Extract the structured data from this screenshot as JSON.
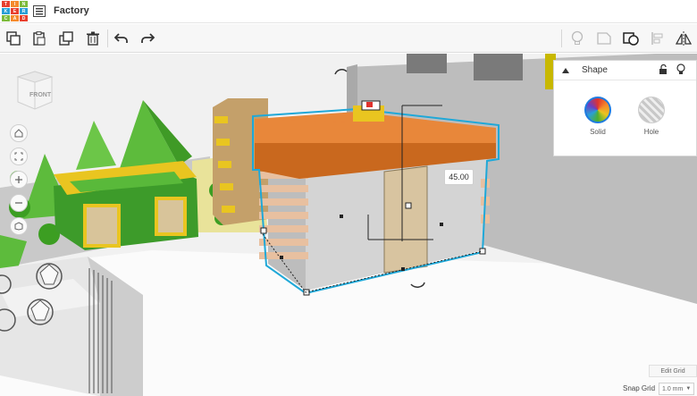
{
  "app": {
    "logo_letters": [
      "T",
      "I",
      "N",
      "K",
      "E",
      "R",
      "C",
      "A",
      "D"
    ],
    "project_name": "Factory"
  },
  "panel": {
    "title": "Shape",
    "solid_label": "Solid",
    "hole_label": "Hole"
  },
  "viewport": {
    "nav_cube_label": "FRONT",
    "dimension_value": "45.00"
  },
  "bottom": {
    "edit_grid": "Edit Grid",
    "snap_grid_label": "Snap Grid",
    "snap_grid_value": "1.0 mm"
  },
  "colors": {
    "orange_roof": "#e8873a",
    "selection_outline": "#1fa8d8",
    "grass": "#4caf2e",
    "yellow_trim": "#e9c520"
  },
  "icons": [
    "project-list-icon",
    "copy-icon",
    "paste-icon",
    "duplicate-icon",
    "trash-icon",
    "undo-icon",
    "redo-icon",
    "light-bulb-icon",
    "note-icon",
    "group-icon",
    "align-icon",
    "mirror-icon",
    "lock-icon",
    "bulb-icon",
    "home-icon",
    "fit-view-icon",
    "zoom-in-icon",
    "zoom-out-icon",
    "perspective-icon"
  ]
}
